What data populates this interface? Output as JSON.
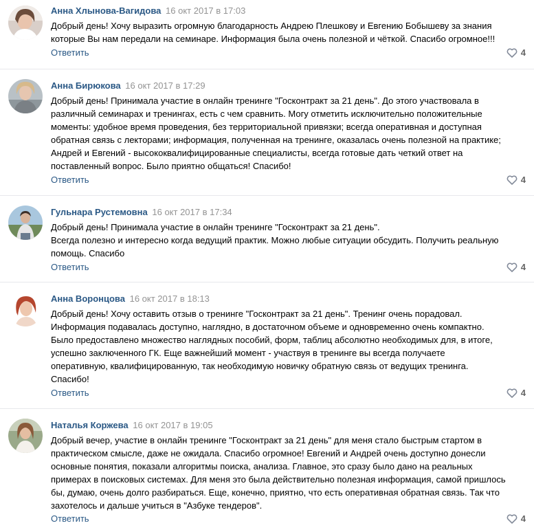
{
  "reply_label": "Ответить",
  "icons": {
    "like": "heart-icon"
  },
  "colors": {
    "author": "#2a5885",
    "date": "#939393",
    "divider": "#e7e8ec",
    "like_icon": "#828a99"
  },
  "comments": [
    {
      "author": "Анна Хлынова-Вагидова",
      "date": "16 окт 2017 в 17:03",
      "lines": [
        "Добрый день! Хочу выразить огромную благодарность Андрею Плешкову и Евгению Бобышеву за знания",
        "которые Вы нам передали на семинаре. Информация была очень полезной и чёткой. Спасибо огромное!!!"
      ],
      "likes": "4"
    },
    {
      "author": "Анна Бирюкова",
      "date": "16 окт 2017 в 17:29",
      "lines": [
        "Добрый день! Принимала участие в онлайн тренинге \"Госконтракт за 21 день\". До этого участвовала в",
        "различный семинарах и тренингах, есть с чем сравнить. Могу отметить исключительно положительные",
        "моменты: удобное время проведения, без территориальной привязки; всегда оперативная и доступная",
        "обратная связь с лекторами; информация, полученная на тренинге, оказалась очень полезной на практике;",
        "Андрей и Евгений - высококвалифицированные специалисты, всегда готовые дать четкий ответ на",
        "поставленный вопрос. Было приятно общаться! Спасибо!"
      ],
      "likes": "4"
    },
    {
      "author": "Гульнара Рустемовна",
      "date": "16 окт 2017 в 17:34",
      "lines": [
        "Добрый день! Принимала участие в онлайн тренинге \"Госконтракт за 21 день\".",
        "Всегда полезно и интересно когда ведущий практик. Можно любые ситуации обсудить. Получить реальную",
        "помощь. Спасибо"
      ],
      "likes": "4"
    },
    {
      "author": "Анна Воронцова",
      "date": "16 окт 2017 в 18:13",
      "lines": [
        "Добрый день! Хочу оставить отзыв о тренинге \"Госконтракт за 21 день\". Тренинг очень порадовал.",
        "Информация подавалась доступно, наглядно, в достаточном объеме и одновременно очень компактно.",
        "Было предоставлено множество наглядных пособий, форм, таблиц абсолютно необходимых для, в итоге,",
        "успешно заключенного ГК. Еще важнейший момент - участвуя в тренинге вы всегда получаете",
        "оперативную, квалифицированную, так необходимую новичку обратную связь от ведущих тренинга.",
        "Спасибо!"
      ],
      "likes": "4"
    },
    {
      "author": "Наталья Коржева",
      "date": "16 окт 2017 в 19:05",
      "lines": [
        "Добрый вечер, участие в онлайн тренинге \"Госконтракт за 21 день\" для меня стало быстрым стартом в",
        "практическом смысле, даже не ожидала. Спасибо огромное! Евгений и Андрей очень доступно донесли",
        "основные понятия, показали алгоритмы поиска, анализа. Главное, это сразу было дано на реальных",
        "примерах в поисковых системах. Для меня это была действительно полезная информация, самой пришлось",
        "бы, думаю, очень долго разбираться. Еще, конечно, приятно, что есть оперативная обратная связь. Так что",
        "захотелось и дальше учиться в \"Азбуке тендеров\"."
      ],
      "likes": "4"
    }
  ]
}
